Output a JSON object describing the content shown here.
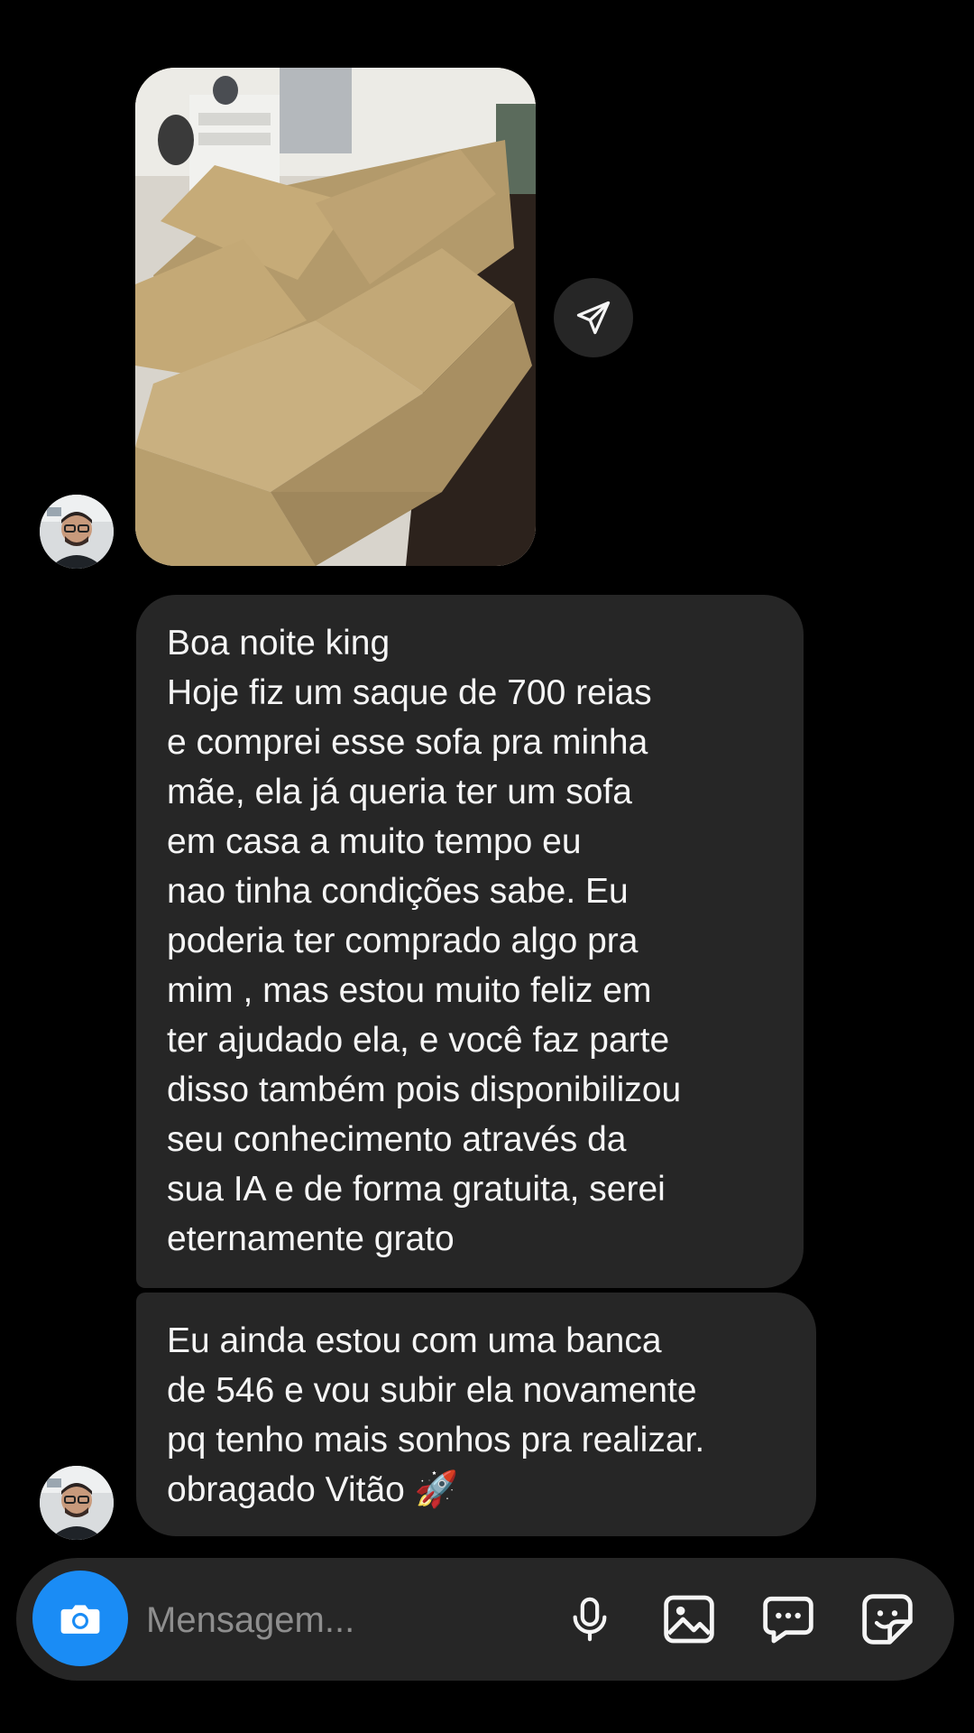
{
  "thread": {
    "photo_message": {
      "alt": "Photo of a beige fabric sofa",
      "share_icon": "paper-plane-icon"
    },
    "messages": [
      {
        "text": "Boa noite king\nHoje fiz um saque de 700 reias\ne comprei esse sofa pra minha\nmãe, ela já queria ter um sofa\nem casa a muito tempo eu\nnao tinha condições sabe. Eu\npoderia ter comprado algo pra\nmim , mas estou muito feliz em\nter ajudado ela, e você faz parte\ndisso também pois disponibilizou\nseu conhecimento através da\nsua IA e de forma gratuita, serei\neternamente grato"
      },
      {
        "text": "Eu ainda estou com uma banca\nde 546 e vou subir ela novamente\npq tenho mais sonhos pra realizar.\nobragado Vitão 🚀"
      }
    ]
  },
  "composer": {
    "placeholder": "Mensagem...",
    "camera_icon": "camera-icon",
    "icons": [
      "microphone-icon",
      "image-icon",
      "chat-bubble-icon",
      "sticker-icon"
    ]
  },
  "colors": {
    "background": "#000000",
    "bubble": "#262626",
    "accent": "#1a8cf5",
    "placeholder": "#8e8e8e"
  }
}
